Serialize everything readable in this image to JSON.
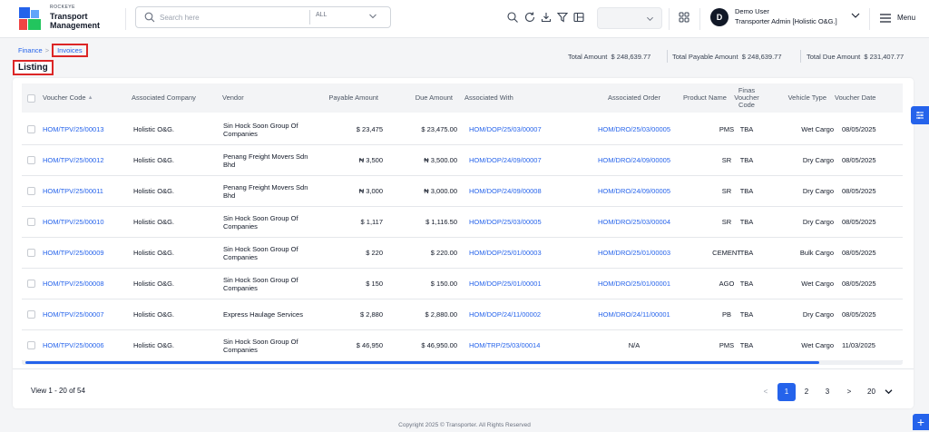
{
  "header": {
    "logo_small": "ROCKEYE",
    "logo_line1": "Transport",
    "logo_line2": "Management",
    "search_placeholder": "Search here",
    "search_scope": "ALL",
    "user_initial": "D",
    "user_name": "Demo User",
    "user_role": "Transporter Admin [Holistic O&G.]",
    "menu_label": "Menu"
  },
  "breadcrumb": {
    "parent": "Finance",
    "separator": ">",
    "current": "Invoices"
  },
  "page_title": "Listing",
  "totals": {
    "total_amount_label": "Total Amount",
    "total_amount": "$ 248,639.77",
    "total_payable_label": "Total Payable Amount",
    "total_payable": "$ 248,639.77",
    "total_due_label": "Total Due Amount",
    "total_due": "$ 231,407.77"
  },
  "table": {
    "columns": {
      "voucher_code": "Voucher Code",
      "company": "Associated Company",
      "vendor": "Vendor",
      "payable": "Payable Amount",
      "due": "Due Amount",
      "assoc_with": "Associated With",
      "assoc_order": "Associated Order",
      "product": "Product Name",
      "finas": "Finas Voucher Code",
      "vehicle": "Vehicle Type",
      "date": "Voucher Date"
    },
    "rows": [
      {
        "code": "HOM/TPV/25/00013",
        "company": "Holistic O&G.",
        "vendor": "Sin Hock Soon Group Of Companies",
        "payable": "$ 23,475",
        "due": "$ 23,475.00",
        "with": "HOM/DOP/25/03/00007",
        "order": "HOM/DRO/25/03/00005",
        "product": "PMS",
        "finas": "TBA",
        "vehicle": "Wet Cargo",
        "date": "08/05/2025"
      },
      {
        "code": "HOM/TPV/25/00012",
        "company": "Holistic O&G.",
        "vendor": "Penang Freight Movers Sdn Bhd",
        "payable": "₦ 3,500",
        "due": "₦ 3,500.00",
        "with": "HOM/DOP/24/09/00007",
        "order": "HOM/DRO/24/09/00005",
        "product": "SR",
        "finas": "TBA",
        "vehicle": "Dry Cargo",
        "date": "08/05/2025"
      },
      {
        "code": "HOM/TPV/25/00011",
        "company": "Holistic O&G.",
        "vendor": "Penang Freight Movers Sdn Bhd",
        "payable": "₦ 3,000",
        "due": "₦ 3,000.00",
        "with": "HOM/DOP/24/09/00008",
        "order": "HOM/DRO/24/09/00005",
        "product": "SR",
        "finas": "TBA",
        "vehicle": "Dry Cargo",
        "date": "08/05/2025"
      },
      {
        "code": "HOM/TPV/25/00010",
        "company": "Holistic O&G.",
        "vendor": "Sin Hock Soon Group Of Companies",
        "payable": "$ 1,117",
        "due": "$ 1,116.50",
        "with": "HOM/DOP/25/03/00005",
        "order": "HOM/DRO/25/03/00004",
        "product": "SR",
        "finas": "TBA",
        "vehicle": "Dry Cargo",
        "date": "08/05/2025"
      },
      {
        "code": "HOM/TPV/25/00009",
        "company": "Holistic O&G.",
        "vendor": "Sin Hock Soon Group Of Companies",
        "payable": "$ 220",
        "due": "$ 220.00",
        "with": "HOM/DOP/25/01/00003",
        "order": "HOM/DRO/25/01/00003",
        "product": "CEMENT",
        "finas": "TBA",
        "vehicle": "Bulk Cargo",
        "date": "08/05/2025"
      },
      {
        "code": "HOM/TPV/25/00008",
        "company": "Holistic O&G.",
        "vendor": "Sin Hock Soon Group Of Companies",
        "payable": "$ 150",
        "due": "$ 150.00",
        "with": "HOM/DOP/25/01/00001",
        "order": "HOM/DRO/25/01/00001",
        "product": "AGO",
        "finas": "TBA",
        "vehicle": "Wet Cargo",
        "date": "08/05/2025"
      },
      {
        "code": "HOM/TPV/25/00007",
        "company": "Holistic O&G.",
        "vendor": "Express Haulage Services",
        "payable": "$ 2,880",
        "due": "$ 2,880.00",
        "with": "HOM/DOP/24/11/00002",
        "order": "HOM/DRO/24/11/00001",
        "product": "PB",
        "finas": "TBA",
        "vehicle": "Dry Cargo",
        "date": "08/05/2025"
      },
      {
        "code": "HOM/TPV/25/00006",
        "company": "Holistic O&G.",
        "vendor": "Sin Hock Soon Group Of Companies",
        "payable": "$ 46,950",
        "due": "$ 46,950.00",
        "with": "HOM/TRP/25/03/00014",
        "order": "N/A",
        "product": "PMS",
        "finas": "TBA",
        "vehicle": "Wet Cargo",
        "date": "11/03/2025"
      }
    ]
  },
  "pagination": {
    "view_info": "View 1 - 20 of 54",
    "prev": "<",
    "pages": [
      "1",
      "2",
      "3"
    ],
    "next": ">",
    "per_page": "20"
  },
  "footer": {
    "copyright": "Copyright 2025 © Transporter. All Rights Reserved"
  },
  "colors": {
    "accent": "#2563eb",
    "highlight_box": "#dc2626"
  }
}
